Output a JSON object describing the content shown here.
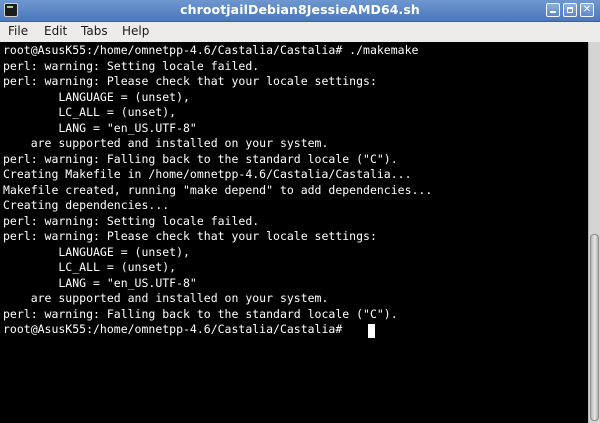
{
  "window": {
    "title": "chrootjailDebian8JessieAMD64.sh"
  },
  "menu": {
    "items": [
      {
        "label": "File"
      },
      {
        "label": "Edit"
      },
      {
        "label": "Tabs"
      },
      {
        "label": "Help"
      }
    ]
  },
  "terminal": {
    "lines": [
      "root@AsusK55:/home/omnetpp-4.6/Castalia/Castalia# ./makemake",
      "perl: warning: Setting locale failed.",
      "perl: warning: Please check that your locale settings:",
      "        LANGUAGE = (unset),",
      "        LC_ALL = (unset),",
      "        LANG = \"en_US.UTF-8\"",
      "    are supported and installed on your system.",
      "perl: warning: Falling back to the standard locale (\"C\").",
      "Creating Makefile in /home/omnetpp-4.6/Castalia/Castalia...",
      "Makefile created, running \"make depend\" to add dependencies...",
      "Creating dependencies...",
      "perl: warning: Setting locale failed.",
      "perl: warning: Please check that your locale settings:",
      "        LANGUAGE = (unset),",
      "        LC_ALL = (unset),",
      "        LANG = \"en_US.UTF-8\"",
      "    are supported and installed on your system.",
      "perl: warning: Falling back to the standard locale (\"C\").",
      "root@AsusK55:/home/omnetpp-4.6/Castalia/Castalia# "
    ]
  },
  "colors": {
    "titlebar": "#4a78bd",
    "terminal_bg": "#000000",
    "terminal_fg": "#ffffff"
  },
  "icons": {
    "app": "terminal-icon",
    "minimize": "minimize-icon",
    "maximize": "maximize-icon",
    "close": "close-icon"
  }
}
